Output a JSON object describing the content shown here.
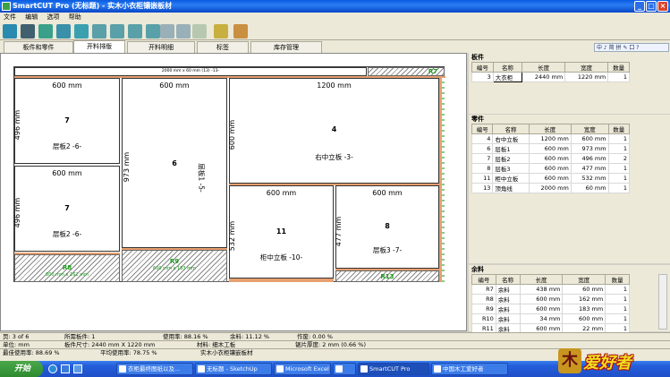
{
  "window": {
    "title": "SmartCUT Pro (无标题) - 实木小衣柜镶嵌板材"
  },
  "menu": [
    "文件",
    "编辑",
    "选项",
    "帮助"
  ],
  "tabs": [
    "板件和零件",
    "开料排版",
    "开料明细",
    "标签",
    "库存管理"
  ],
  "ime": "中 ♪ 简 拼 ✎ 囗 ?",
  "sheet": {
    "top_label": "2000 mm x 60 mm (13) -13-",
    "r7": "R7",
    "parts": [
      {
        "id": "p7a",
        "w": "600 mm",
        "h": "496 mm",
        "num": "7",
        "name": "层板2 -6-"
      },
      {
        "id": "p7b",
        "w": "600 mm",
        "h": "496 mm",
        "num": "7",
        "name": "层板2 -6-"
      },
      {
        "id": "p6",
        "w": "600 mm",
        "h": "973 mm",
        "num": "6",
        "name": "层板1 -5-"
      },
      {
        "id": "p4",
        "w": "1200 mm",
        "h": "600 mm",
        "num": "4",
        "name": "右中立板 -3-"
      },
      {
        "id": "p11",
        "w": "600 mm",
        "h": "532 mm",
        "num": "11",
        "name": "柜中立板 -10-"
      },
      {
        "id": "p8",
        "w": "600 mm",
        "h": "477 mm",
        "num": "8",
        "name": "层板3 -7-"
      }
    ],
    "remnants": [
      {
        "id": "R8",
        "sub": "600 mm x 162 mm"
      },
      {
        "id": "R9",
        "sub": "600 mm x 183 mm"
      },
      {
        "id": "R13",
        "sub": ""
      }
    ]
  },
  "boards": {
    "header": "板件",
    "cols": [
      "编号",
      "名称",
      "长度",
      "宽度",
      "数量"
    ],
    "rows": [
      [
        "3",
        "大衣柜",
        "2440 mm",
        "1220 mm",
        "1"
      ]
    ]
  },
  "parts": {
    "header": "零件",
    "cols": [
      "编号",
      "名称",
      "长度",
      "宽度",
      "数量"
    ],
    "rows": [
      [
        "4",
        "右中立板",
        "1200 mm",
        "600 mm",
        "1"
      ],
      [
        "6",
        "层板1",
        "600 mm",
        "973 mm",
        "1"
      ],
      [
        "7",
        "层板2",
        "600 mm",
        "496 mm",
        "2"
      ],
      [
        "8",
        "层板3",
        "600 mm",
        "477 mm",
        "1"
      ],
      [
        "11",
        "柜中立板",
        "600 mm",
        "532 mm",
        "1"
      ],
      [
        "13",
        "顶角线",
        "2000 mm",
        "60 mm",
        "1"
      ]
    ]
  },
  "remnants_table": {
    "header": "余料",
    "cols": [
      "编号",
      "名称",
      "长度",
      "宽度",
      "数量"
    ],
    "rows": [
      [
        "R7",
        "余料",
        "438 mm",
        "60 mm",
        "1"
      ],
      [
        "R8",
        "余料",
        "600 mm",
        "162 mm",
        "1"
      ],
      [
        "R9",
        "余料",
        "600 mm",
        "183 mm",
        "1"
      ],
      [
        "R10",
        "余料",
        "34 mm",
        "600 mm",
        "1"
      ],
      [
        "R11",
        "余料",
        "600 mm",
        "22 mm",
        "1"
      ]
    ]
  },
  "status": {
    "row1": {
      "page": "页: 3 of 6",
      "sheets": "所需板件: 1",
      "usage": "使用率: 88.16 %",
      "waste": "余料: 11.12 %",
      "ops": "作废: 0.00 %"
    },
    "row2": {
      "unit": "单位: mm",
      "size": "板件尺寸: 2440 mm X 1220 mm",
      "material": "材料: 细木工板",
      "thick": "锯片厚度: 2 mm  (0.66 %)"
    },
    "row3": {
      "best": "最佳使用率: 88.69 %",
      "avg": "平均使用率: 78.75 %",
      "project": "实木小衣柜镶嵌板材"
    }
  },
  "taskbar": {
    "start": "开始",
    "items": [
      "衣柜最终图纸以及...",
      "无标题 - SketchUp",
      "Microsoft Excel",
      "",
      "SmartCUT Pro",
      "中国木工爱好者"
    ]
  },
  "logo": {
    "text": "爱好者"
  }
}
